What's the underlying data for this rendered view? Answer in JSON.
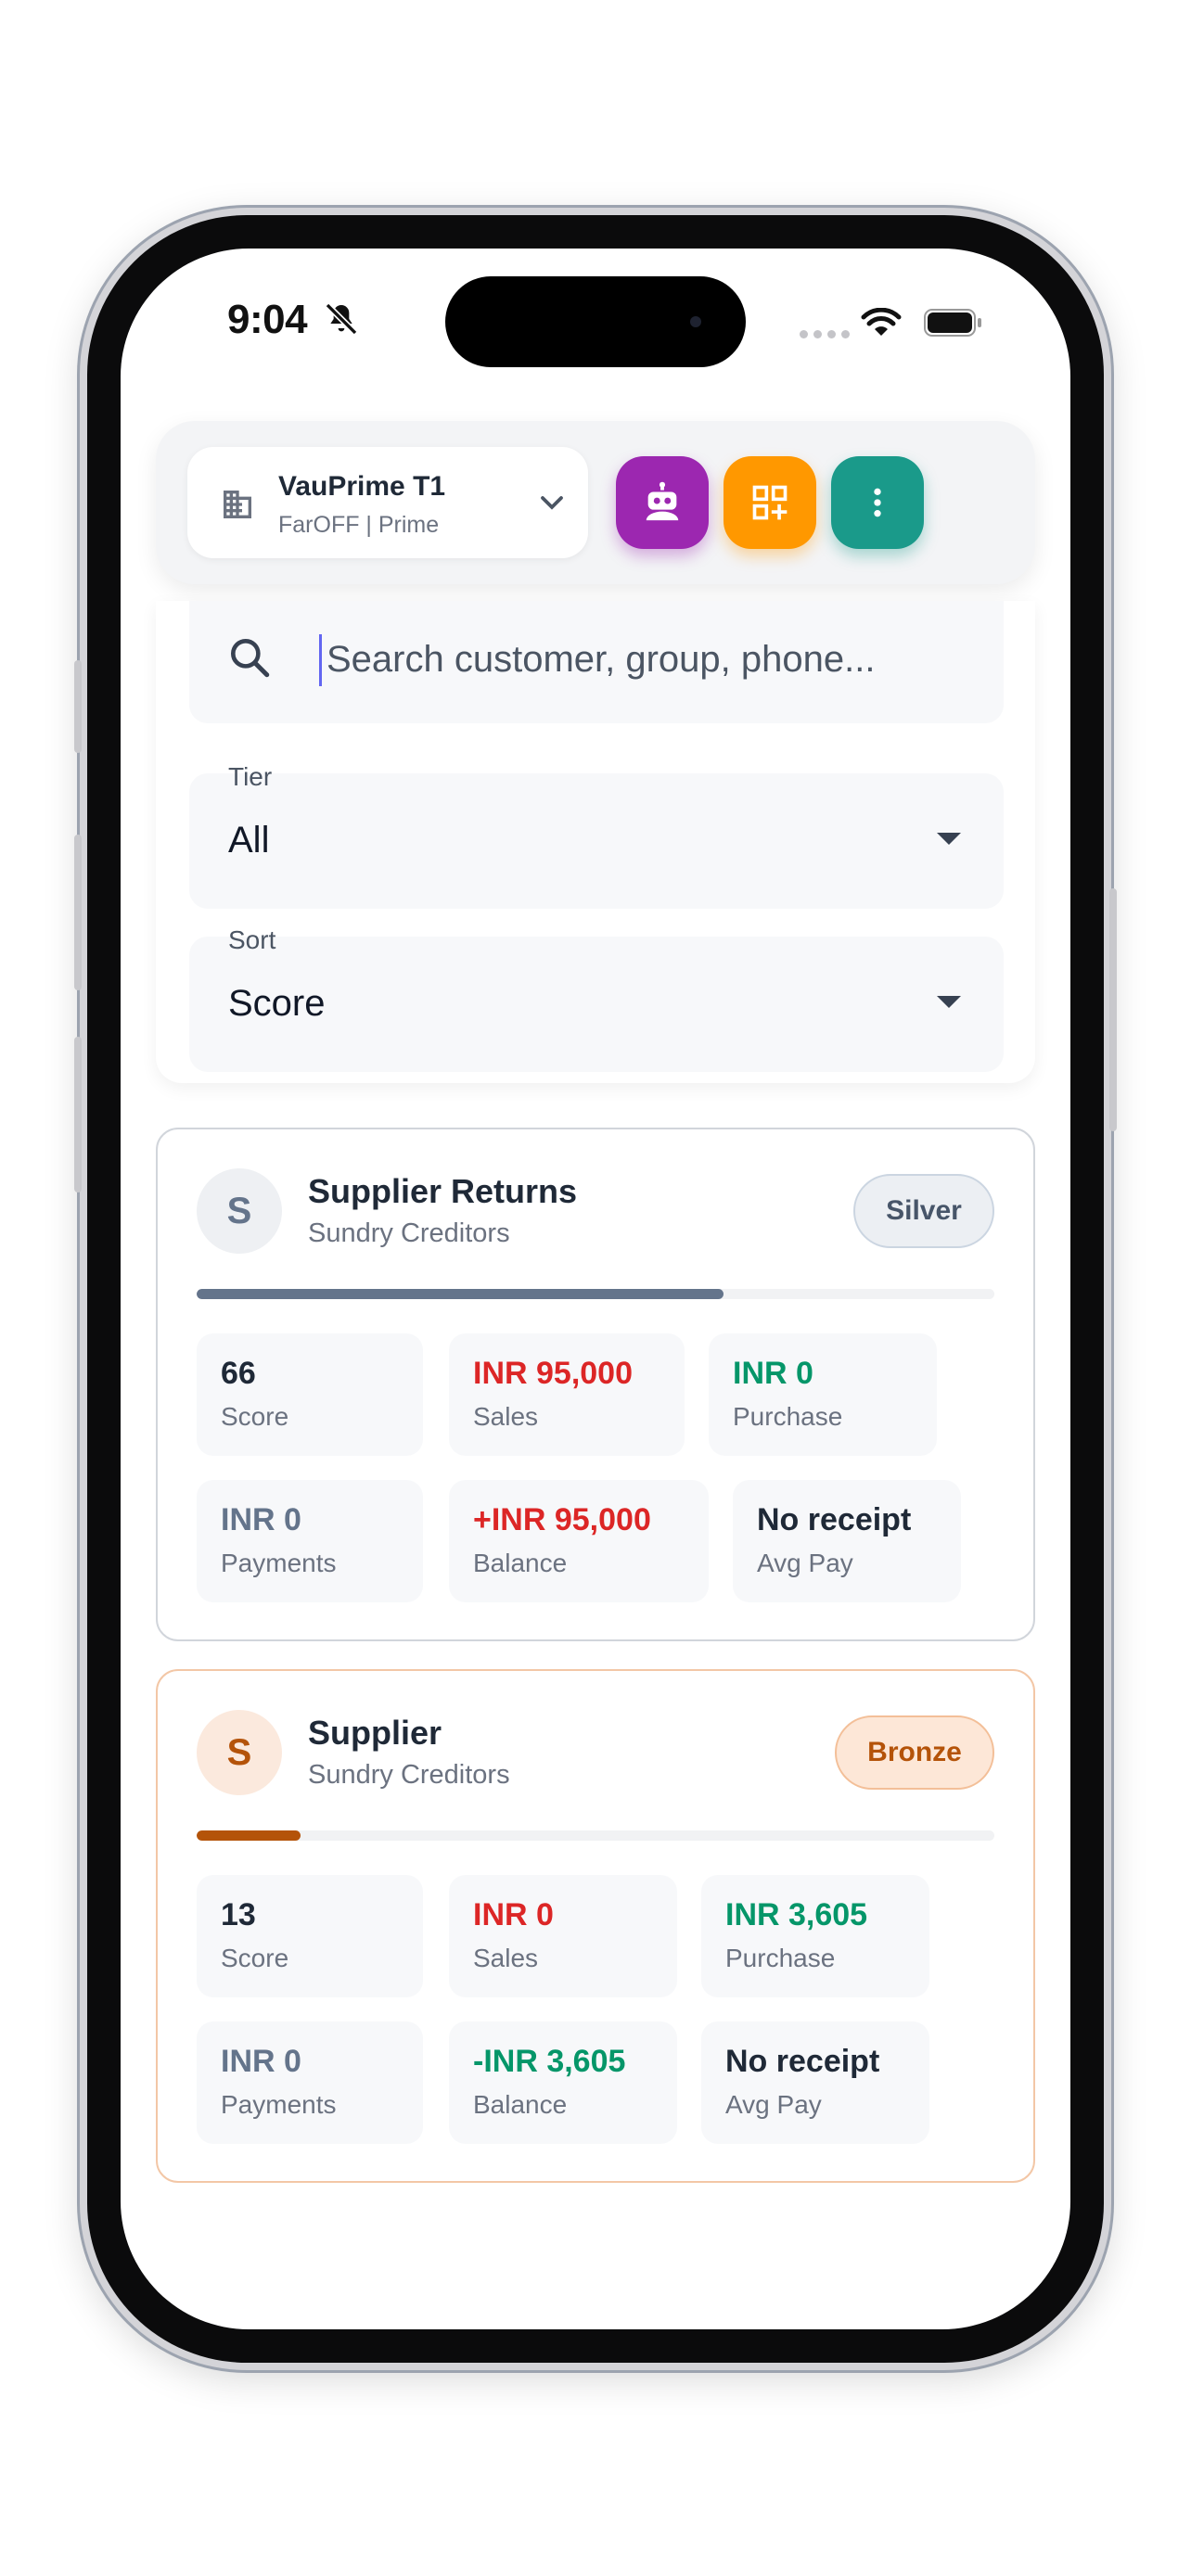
{
  "status_bar": {
    "time": "9:04"
  },
  "header": {
    "company_name": "VauPrime T1",
    "company_sub": "FarOFF | Prime",
    "actions": [
      {
        "icon": "robot-icon",
        "color": "#9c27b0"
      },
      {
        "icon": "add-grid-icon",
        "color": "#ff9800"
      },
      {
        "icon": "more-vertical-icon",
        "color": "#1a9a8a"
      }
    ]
  },
  "filters": {
    "search_placeholder": "Search customer, group, phone...",
    "tier": {
      "label": "Tier",
      "value": "All"
    },
    "sort": {
      "label": "Sort",
      "value": "Score"
    }
  },
  "customers": [
    {
      "initial": "S",
      "name": "Supplier Returns",
      "group": "Sundry Creditors",
      "tier": "Silver",
      "score_fraction": 0.66,
      "progress_color": "#64748b",
      "stats": [
        {
          "value": "66",
          "label": "Score",
          "tone": "dark"
        },
        {
          "value": "INR 95,000",
          "label": "Sales",
          "tone": "red"
        },
        {
          "value": "INR 0",
          "label": "Purchase",
          "tone": "green"
        },
        {
          "value": "INR 0",
          "label": "Payments",
          "tone": "grey"
        },
        {
          "value": "+INR 95,000",
          "label": "Balance",
          "tone": "red"
        },
        {
          "value": "No receipt",
          "label": "Avg Pay",
          "tone": "dark"
        }
      ]
    },
    {
      "initial": "S",
      "name": "Supplier",
      "group": "Sundry Creditors",
      "tier": "Bronze",
      "score_fraction": 0.13,
      "progress_color": "#b45309",
      "stats": [
        {
          "value": "13",
          "label": "Score",
          "tone": "dark"
        },
        {
          "value": "INR 0",
          "label": "Sales",
          "tone": "red"
        },
        {
          "value": "INR 3,605",
          "label": "Purchase",
          "tone": "green"
        },
        {
          "value": "INR 0",
          "label": "Payments",
          "tone": "grey"
        },
        {
          "value": "-INR 3,605",
          "label": "Balance",
          "tone": "green"
        },
        {
          "value": "No receipt",
          "label": "Avg Pay",
          "tone": "dark"
        }
      ]
    }
  ]
}
